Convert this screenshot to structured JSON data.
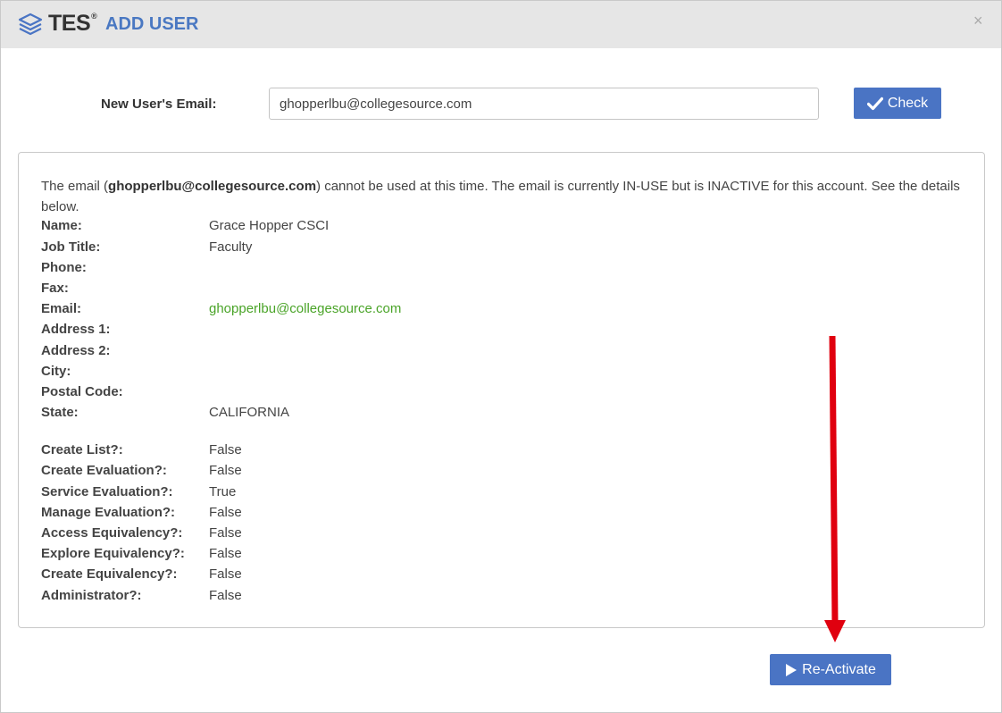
{
  "header": {
    "brand": "TES",
    "brand_mark": "®",
    "title": "ADD USER",
    "close": "×"
  },
  "form": {
    "email_label": "New User's Email:",
    "email_value": "ghopperlbu@collegesource.com",
    "check_label": "Check"
  },
  "message": {
    "prefix": "The email (",
    "email": "ghopperlbu@collegesource.com",
    "suffix": ") cannot be used at this time. The email is currently IN-USE but is INACTIVE for this account. See the details below."
  },
  "details": [
    {
      "label": "Name:",
      "value": "Grace Hopper CSCI"
    },
    {
      "label": "Job Title:",
      "value": "Faculty"
    },
    {
      "label": "Phone:",
      "value": ""
    },
    {
      "label": "Fax:",
      "value": ""
    },
    {
      "label": "Email:",
      "value": "ghopperlbu@collegesource.com"
    },
    {
      "label": "Address 1:",
      "value": ""
    },
    {
      "label": "Address 2:",
      "value": ""
    },
    {
      "label": "City:",
      "value": ""
    },
    {
      "label": "Postal Code:",
      "value": ""
    },
    {
      "label": "State:",
      "value": "CALIFORNIA"
    }
  ],
  "permissions": [
    {
      "label": "Create List?:",
      "value": "False"
    },
    {
      "label": "Create Evaluation?:",
      "value": "False"
    },
    {
      "label": "Service Evaluation?:",
      "value": "True"
    },
    {
      "label": "Manage Evaluation?:",
      "value": "False"
    },
    {
      "label": "Access Equivalency?:",
      "value": "False"
    },
    {
      "label": "Explore Equivalency?:",
      "value": "False"
    },
    {
      "label": "Create Equivalency?:",
      "value": "False"
    },
    {
      "label": "Administrator?:",
      "value": "False"
    }
  ],
  "actions": {
    "reactivate_label": "Re-Activate"
  },
  "colors": {
    "accent": "#4a74c4",
    "title": "#4a78c2",
    "link_green": "#4aa428",
    "annotation_arrow": "#e0000f"
  },
  "icons": {
    "logo": "layers-icon",
    "check": "checkmark-icon",
    "play": "play-icon",
    "close": "close-icon"
  }
}
